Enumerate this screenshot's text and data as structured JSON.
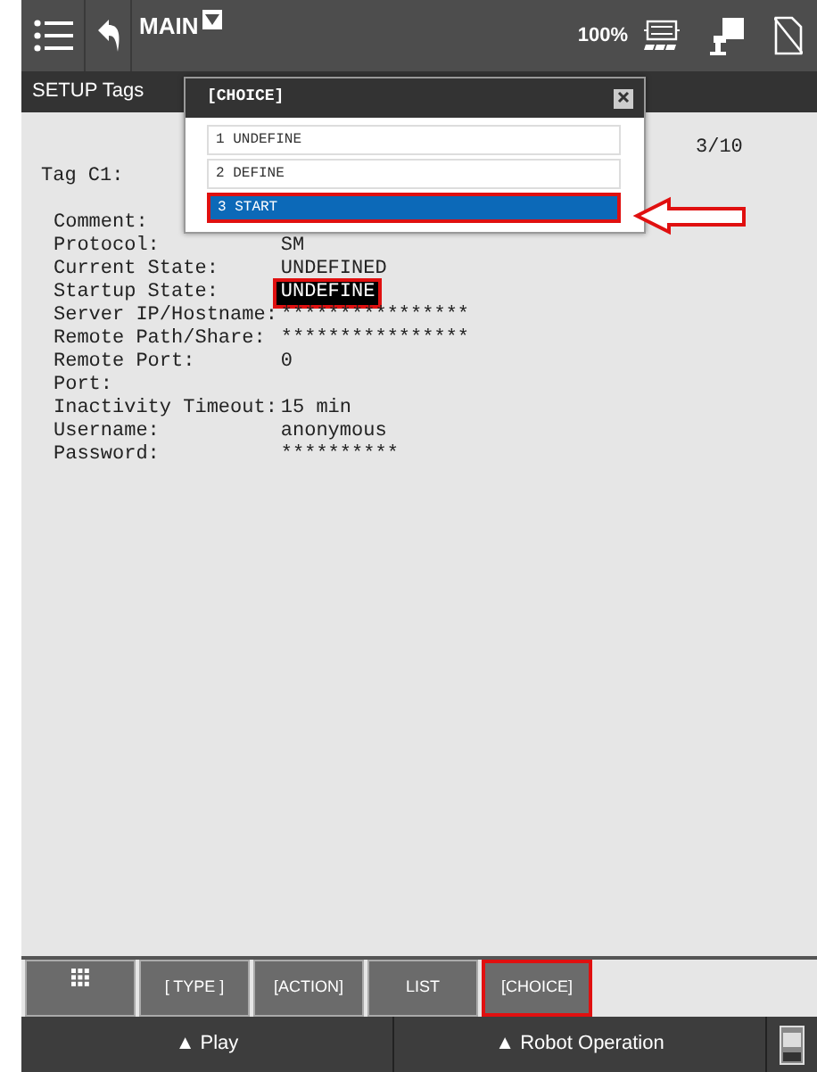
{
  "top_bar": {
    "program": "MAIN",
    "speed": "100%"
  },
  "sub_bar": {
    "title": "SETUP Tags"
  },
  "content": {
    "page": "3/10",
    "tag": "Tag C1:",
    "fields": [
      {
        "label": "Comment:"
      },
      {
        "label": "Protocol:",
        "value": "SM",
        "highlighted": false
      },
      {
        "label": "Current State:",
        "value": "UNDEFINED",
        "highlighted": false
      },
      {
        "label": "Startup State:",
        "value": "UNDEFINE",
        "highlighted": true
      },
      {
        "label": "Server IP/Hostname:",
        "value": "****************",
        "highlighted": false
      },
      {
        "label": "Remote Path/Share:",
        "value": "****************",
        "highlighted": false
      },
      {
        "label": "Remote Port:",
        "value": "0",
        "highlighted": false
      },
      {
        "label": "Port:"
      },
      {
        "label": "Inactivity Timeout:",
        "value": "15 min",
        "highlighted": false
      },
      {
        "label": "Username:",
        "value": "anonymous",
        "highlighted": false
      },
      {
        "label": "Password:",
        "value": "**********",
        "highlighted": false
      }
    ]
  },
  "popup": {
    "title": "[CHOICE]",
    "items": [
      {
        "label": "1 UNDEFINE",
        "selected": false
      },
      {
        "label": "2 DEFINE",
        "selected": false
      },
      {
        "label": "3 START",
        "selected": true
      }
    ]
  },
  "function_keys": [
    {
      "kind": "grid",
      "highlighted": false
    },
    {
      "kind": "text",
      "label": "[ TYPE ]",
      "highlighted": false
    },
    {
      "kind": "text",
      "label": "[ACTION]",
      "highlighted": false
    },
    {
      "kind": "text",
      "label": "LIST",
      "highlighted": false
    },
    {
      "kind": "text",
      "label": "[CHOICE]",
      "highlighted": true
    }
  ],
  "bottom_bar": [
    "▲ Play",
    "▲ Robot Operation"
  ]
}
